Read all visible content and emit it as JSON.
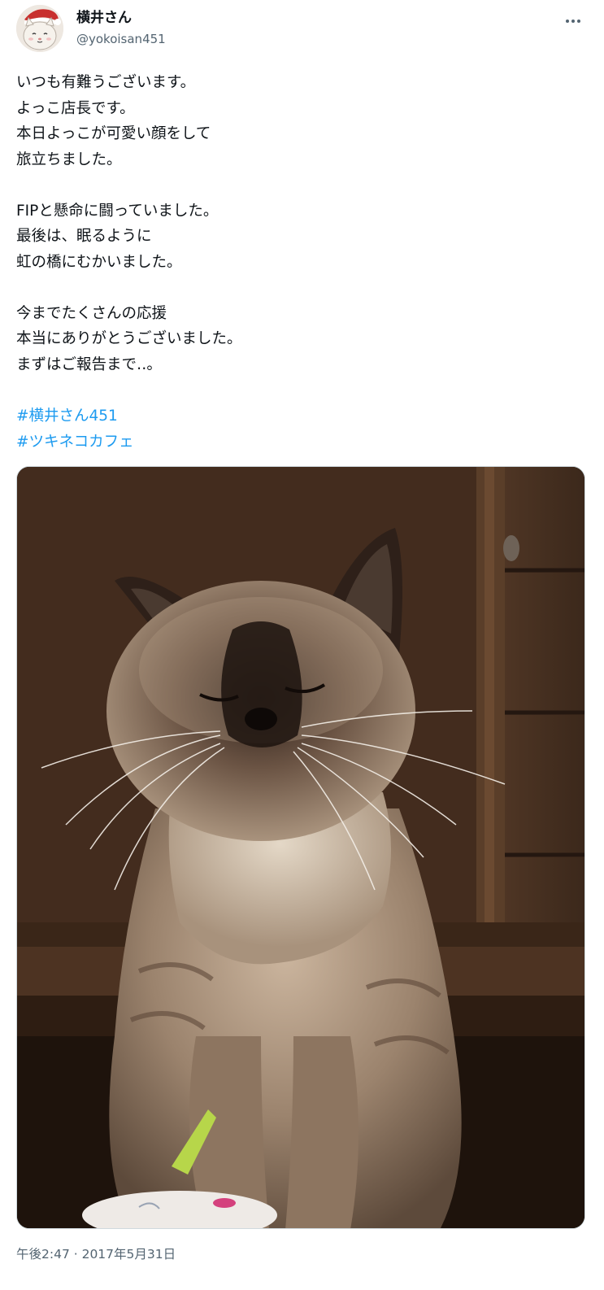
{
  "author": {
    "display_name": "横井さん",
    "handle": "@yokoisan451"
  },
  "tweet": {
    "text": "いつも有難うございます。\nよっこ店長です。\n本日よっこが可愛い顔をして\n旅立ちました。\n\nFIPと懸命に闘っていました。\n最後は、眠るように\n虹の橋にむかいました。\n\n今までたくさんの応援\n本当にありがとうございました。\nまずはご報告まで‥。",
    "hashtags": [
      "#横井さん451",
      "#ツキネコカフェ"
    ],
    "timestamp": "午後2:47 · 2017年5月31日"
  },
  "icons": {
    "more": "more-horizontal-icon",
    "avatar": "cat-avatar-icon"
  },
  "colors": {
    "link": "#1d9bf0",
    "secondary_text": "#536471",
    "primary_text": "#0f1419"
  }
}
